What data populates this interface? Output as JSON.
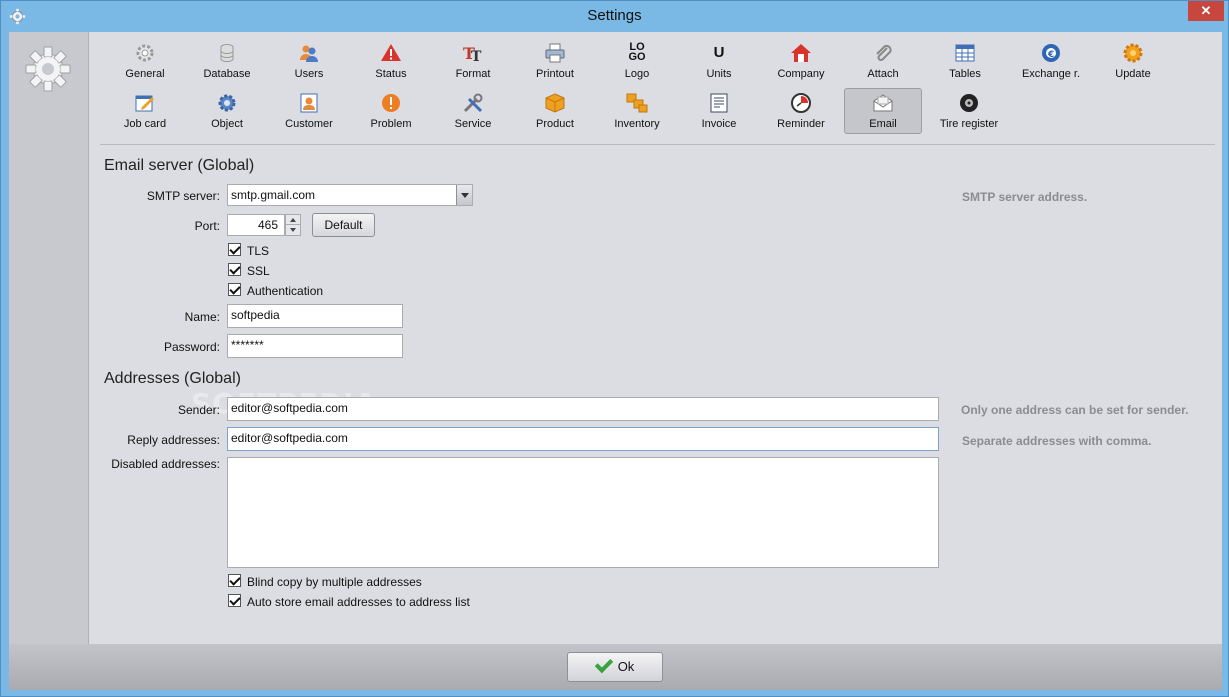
{
  "window": {
    "title": "Settings",
    "close_label": "✕"
  },
  "toolbar": {
    "row1": [
      {
        "label": "General",
        "icon": "gear-icon"
      },
      {
        "label": "Database",
        "icon": "database-icon"
      },
      {
        "label": "Users",
        "icon": "users-icon"
      },
      {
        "label": "Status",
        "icon": "warning-icon"
      },
      {
        "label": "Format",
        "icon": "format-icon"
      },
      {
        "label": "Printout",
        "icon": "printer-icon"
      },
      {
        "label": "Logo",
        "icon": "logo-icon"
      },
      {
        "label": "Units",
        "icon": "units-icon"
      },
      {
        "label": "Company",
        "icon": "company-house-icon"
      },
      {
        "label": "Attach",
        "icon": "paperclip-icon"
      },
      {
        "label": "Tables",
        "icon": "table-icon"
      },
      {
        "label": "Exchange r.",
        "icon": "exchange-rate-icon"
      },
      {
        "label": "Update",
        "icon": "update-icon"
      }
    ],
    "row2": [
      {
        "label": "Job card",
        "icon": "job-card-icon"
      },
      {
        "label": "Object",
        "icon": "object-gear-icon"
      },
      {
        "label": "Customer",
        "icon": "customer-icon"
      },
      {
        "label": "Problem",
        "icon": "problem-icon"
      },
      {
        "label": "Service",
        "icon": "service-tools-icon"
      },
      {
        "label": "Product",
        "icon": "product-box-icon"
      },
      {
        "label": "Inventory",
        "icon": "inventory-boxes-icon"
      },
      {
        "label": "Invoice",
        "icon": "invoice-icon"
      },
      {
        "label": "Reminder",
        "icon": "reminder-clock-icon"
      },
      {
        "label": "Email",
        "icon": "email-icon",
        "active": true
      },
      {
        "label": "Tire register",
        "icon": "tire-icon"
      }
    ],
    "logo_glyph_top": "LO",
    "logo_glyph_bottom": "GO",
    "units_glyph": "U"
  },
  "email_server": {
    "section_title": "Email server (Global)",
    "smtp_label": "SMTP server:",
    "smtp_value": "smtp.gmail.com",
    "smtp_hint": "SMTP server address.",
    "port_label": "Port:",
    "port_value": "465",
    "default_button": "Default",
    "tls_label": "TLS",
    "tls_checked": true,
    "ssl_label": "SSL",
    "ssl_checked": true,
    "auth_label": "Authentication",
    "auth_checked": true,
    "name_label": "Name:",
    "name_value": "softpedia",
    "password_label": "Password:",
    "password_value": "*******"
  },
  "addresses": {
    "section_title": "Addresses (Global)",
    "sender_label": "Sender:",
    "sender_value": "editor@softpedia.com",
    "sender_hint": "Only one address can be set for sender.",
    "reply_label": "Reply addresses:",
    "reply_value": "editor@softpedia.com",
    "reply_hint": "Separate addresses with comma.",
    "disabled_label": "Disabled addresses:",
    "disabled_value": "",
    "blind_copy_label": "Blind copy by multiple addresses",
    "blind_copy_checked": true,
    "auto_store_label": "Auto store email addresses to address list",
    "auto_store_checked": true
  },
  "watermark": "SOFTPEDIA",
  "footer": {
    "ok_label": "Ok"
  },
  "colors": {
    "titlebar": "#7ab9e6",
    "close": "#c7463e",
    "ok_check": "#3aa23a",
    "hint": "#8a8c92"
  }
}
